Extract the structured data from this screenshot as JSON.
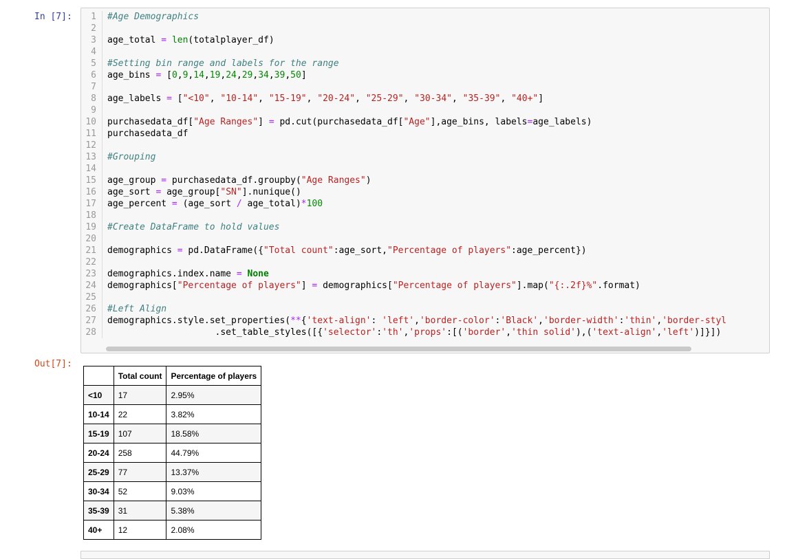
{
  "prompts": {
    "in": "In [7]:",
    "out": "Out[7]:"
  },
  "code": [
    [
      [
        "c",
        "#Age Demographics"
      ]
    ],
    [],
    [
      [
        "t",
        "age_total "
      ],
      [
        "o",
        "="
      ],
      [
        "t",
        " "
      ],
      [
        "nb",
        "len"
      ],
      [
        "t",
        "(totalplayer_df)"
      ]
    ],
    [],
    [
      [
        "c",
        "#Setting bin range and labels for the range"
      ]
    ],
    [
      [
        "t",
        "age_bins "
      ],
      [
        "o",
        "="
      ],
      [
        "t",
        " ["
      ],
      [
        "n",
        "0"
      ],
      [
        "t",
        ","
      ],
      [
        "n",
        "9"
      ],
      [
        "t",
        ","
      ],
      [
        "n",
        "14"
      ],
      [
        "t",
        ","
      ],
      [
        "n",
        "19"
      ],
      [
        "t",
        ","
      ],
      [
        "n",
        "24"
      ],
      [
        "t",
        ","
      ],
      [
        "n",
        "29"
      ],
      [
        "t",
        ","
      ],
      [
        "n",
        "34"
      ],
      [
        "t",
        ","
      ],
      [
        "n",
        "39"
      ],
      [
        "t",
        ","
      ],
      [
        "n",
        "50"
      ],
      [
        "t",
        "]"
      ]
    ],
    [],
    [
      [
        "t",
        "age_labels "
      ],
      [
        "o",
        "="
      ],
      [
        "t",
        " ["
      ],
      [
        "s",
        "\"<10\""
      ],
      [
        "t",
        ", "
      ],
      [
        "s",
        "\"10-14\""
      ],
      [
        "t",
        ", "
      ],
      [
        "s",
        "\"15-19\""
      ],
      [
        "t",
        ", "
      ],
      [
        "s",
        "\"20-24\""
      ],
      [
        "t",
        ", "
      ],
      [
        "s",
        "\"25-29\""
      ],
      [
        "t",
        ", "
      ],
      [
        "s",
        "\"30-34\""
      ],
      [
        "t",
        ", "
      ],
      [
        "s",
        "\"35-39\""
      ],
      [
        "t",
        ", "
      ],
      [
        "s",
        "\"40+\""
      ],
      [
        "t",
        "]"
      ]
    ],
    [],
    [
      [
        "t",
        "purchasedata_df["
      ],
      [
        "s",
        "\"Age Ranges\""
      ],
      [
        "t",
        "] "
      ],
      [
        "o",
        "="
      ],
      [
        "t",
        " pd.cut(purchasedata_df["
      ],
      [
        "s",
        "\"Age\""
      ],
      [
        "t",
        "],age_bins, labels"
      ],
      [
        "o",
        "="
      ],
      [
        "t",
        "age_labels)"
      ]
    ],
    [
      [
        "t",
        "purchasedata_df"
      ]
    ],
    [],
    [
      [
        "c",
        "#Grouping"
      ]
    ],
    [],
    [
      [
        "t",
        "age_group "
      ],
      [
        "o",
        "="
      ],
      [
        "t",
        " purchasedata_df.groupby("
      ],
      [
        "s",
        "\"Age Ranges\""
      ],
      [
        "t",
        ")"
      ]
    ],
    [
      [
        "t",
        "age_sort "
      ],
      [
        "o",
        "="
      ],
      [
        "t",
        " age_group["
      ],
      [
        "s",
        "\"SN\""
      ],
      [
        "t",
        "].nunique()"
      ]
    ],
    [
      [
        "t",
        "age_percent "
      ],
      [
        "o",
        "="
      ],
      [
        "t",
        " (age_sort "
      ],
      [
        "o",
        "/"
      ],
      [
        "t",
        " age_total)"
      ],
      [
        "o",
        "*"
      ],
      [
        "n",
        "100"
      ]
    ],
    [],
    [
      [
        "c",
        "#Create DataFrame to hold values"
      ]
    ],
    [],
    [
      [
        "t",
        "demographics "
      ],
      [
        "o",
        "="
      ],
      [
        "t",
        " pd.DataFrame({"
      ],
      [
        "s",
        "\"Total count\""
      ],
      [
        "t",
        ":age_sort,"
      ],
      [
        "s",
        "\"Percentage of players\""
      ],
      [
        "t",
        ":age_percent})"
      ]
    ],
    [],
    [
      [
        "t",
        "demographics.index.name "
      ],
      [
        "o",
        "="
      ],
      [
        "t",
        " "
      ],
      [
        "k",
        "None"
      ]
    ],
    [
      [
        "t",
        "demographics["
      ],
      [
        "s",
        "\"Percentage of players\""
      ],
      [
        "t",
        "] "
      ],
      [
        "o",
        "="
      ],
      [
        "t",
        " demographics["
      ],
      [
        "s",
        "\"Percentage of players\""
      ],
      [
        "t",
        "].map("
      ],
      [
        "s",
        "\"{:.2f}%\""
      ],
      [
        "t",
        ".format)"
      ]
    ],
    [],
    [
      [
        "c",
        "#Left Align"
      ]
    ],
    [
      [
        "t",
        "demographics.style.set_properties("
      ],
      [
        "o",
        "**"
      ],
      [
        "t",
        "{"
      ],
      [
        "s",
        "'text-align'"
      ],
      [
        "t",
        ": "
      ],
      [
        "s",
        "'left'"
      ],
      [
        "t",
        ","
      ],
      [
        "s",
        "'border-color'"
      ],
      [
        "t",
        ":"
      ],
      [
        "s",
        "'Black'"
      ],
      [
        "t",
        ","
      ],
      [
        "s",
        "'border-width'"
      ],
      [
        "t",
        ":"
      ],
      [
        "s",
        "'thin'"
      ],
      [
        "t",
        ","
      ],
      [
        "s",
        "'border-styl"
      ]
    ],
    [
      [
        "t",
        "                    .set_table_styles([{"
      ],
      [
        "s",
        "'selector'"
      ],
      [
        "t",
        ":"
      ],
      [
        "s",
        "'th'"
      ],
      [
        "t",
        ","
      ],
      [
        "s",
        "'props'"
      ],
      [
        "t",
        ":[("
      ],
      [
        "s",
        "'border'"
      ],
      [
        "t",
        ","
      ],
      [
        "s",
        "'thin solid'"
      ],
      [
        "t",
        "),("
      ],
      [
        "s",
        "'text-align'"
      ],
      [
        "t",
        ","
      ],
      [
        "s",
        "'left'"
      ],
      [
        "t",
        ")]}])"
      ]
    ]
  ],
  "table": {
    "headers": [
      "",
      "Total count",
      "Percentage of players"
    ],
    "rows": [
      [
        "<10",
        "17",
        "2.95%"
      ],
      [
        "10-14",
        "22",
        "3.82%"
      ],
      [
        "15-19",
        "107",
        "18.58%"
      ],
      [
        "20-24",
        "258",
        "44.79%"
      ],
      [
        "25-29",
        "77",
        "13.37%"
      ],
      [
        "30-34",
        "52",
        "9.03%"
      ],
      [
        "35-39",
        "31",
        "5.38%"
      ],
      [
        "40+",
        "12",
        "2.08%"
      ]
    ]
  }
}
